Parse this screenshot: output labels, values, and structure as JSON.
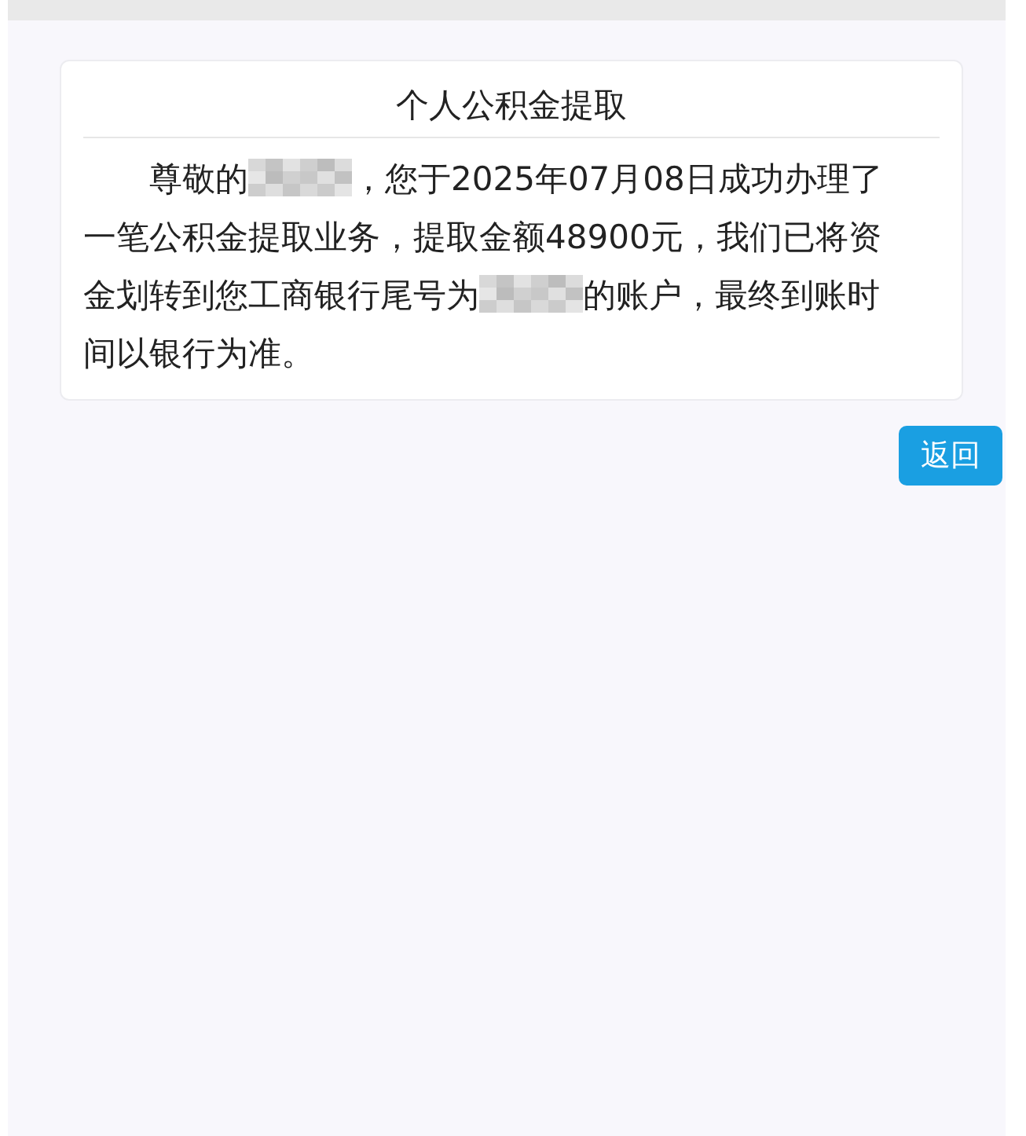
{
  "card": {
    "title": "个人公积金提取",
    "message": [
      {
        "kind": "text",
        "text": "尊敬的"
      },
      {
        "kind": "redacted"
      },
      {
        "kind": "text",
        "text": "，您于2025年07月08日成功办理了一笔公积金提取业务，提取金额48900元，我们已将资金划转到您工商银行尾号为"
      },
      {
        "kind": "redacted"
      },
      {
        "kind": "text",
        "text": "的账户，最终到账时间以银行为准。"
      }
    ]
  },
  "buttons": [
    {
      "label": "返回"
    }
  ]
}
